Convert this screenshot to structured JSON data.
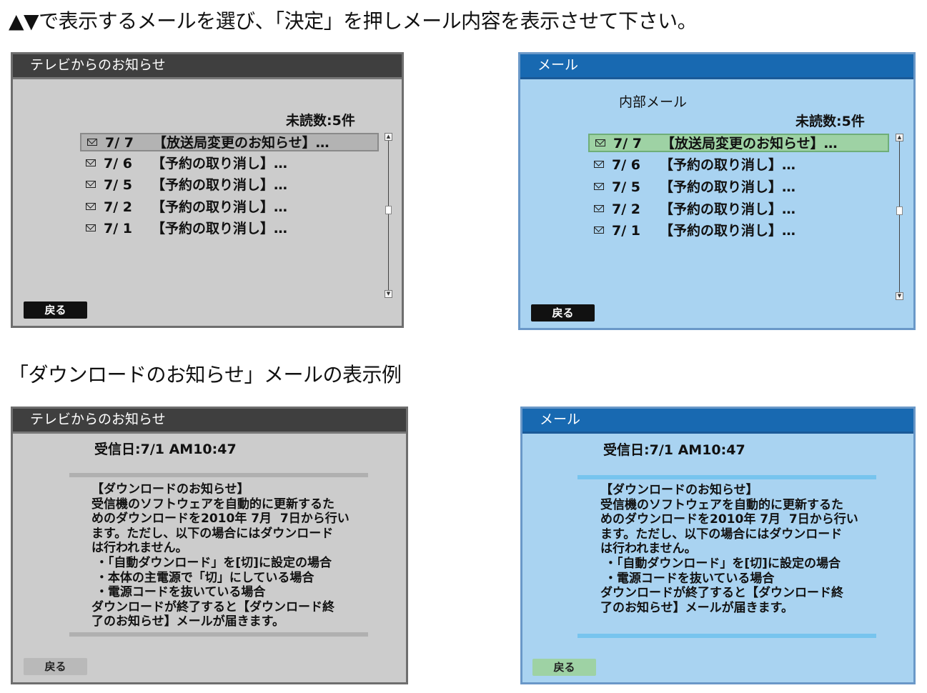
{
  "instruction": "▲▼で表示するメールを選び、「決定」を押しメール内容を表示させて下さい。",
  "example_heading": "「ダウンロードのお知らせ」メールの表示例",
  "gray_list": {
    "title": "テレビからのお知らせ",
    "unread": "未読数:5件",
    "back": "戻る",
    "rows": [
      {
        "date": "7/ 7",
        "subject": "【放送局変更のお知らせ】…"
      },
      {
        "date": "7/ 6",
        "subject": "【予約の取り消し】…"
      },
      {
        "date": "7/ 5",
        "subject": "【予約の取り消し】…"
      },
      {
        "date": "7/ 2",
        "subject": "【予約の取り消し】…"
      },
      {
        "date": "7/ 1",
        "subject": "【予約の取り消し】…"
      }
    ]
  },
  "blue_list": {
    "title": "メール",
    "subtitle": "内部メール",
    "unread": "未読数:5件",
    "back": "戻る",
    "rows": [
      {
        "date": "7/ 7",
        "subject": "【放送局変更のお知らせ】…"
      },
      {
        "date": "7/ 6",
        "subject": "【予約の取り消し】…"
      },
      {
        "date": "7/ 5",
        "subject": "【予約の取り消し】…"
      },
      {
        "date": "7/ 2",
        "subject": "【予約の取り消し】…"
      },
      {
        "date": "7/ 1",
        "subject": "【予約の取り消し】…"
      }
    ]
  },
  "gray_detail": {
    "title": "テレビからのお知らせ",
    "received": "受信日:7/1 AM10:47",
    "body": "【ダウンロードのお知らせ】\n受信機のソフトウェアを自動的に更新するた\nめのダウンロードを2010年 7月  7日から行い\nます。ただし、以下の場合にはダウンロード\nは行われません。\n ・「自動ダウンロード」を[切]に設定の場合\n ・本体の主電源で「切」にしている場合\n ・電源コードを抜いている場合\nダウンロードが終了すると【ダウンロード終\n了のお知らせ】メールが届きます。",
    "back": "戻る"
  },
  "blue_detail": {
    "title": "メール",
    "received": "受信日:7/1 AM10:47",
    "body": "【ダウンロードのお知らせ】\n受信機のソフトウェアを自動的に更新するた\nめのダウンロードを2010年 7月  7日から行い\nます。ただし、以下の場合にはダウンロード\nは行われません。\n ・「自動ダウンロード」を[切]に設定の場合\n ・電源コードを抜いている場合\nダウンロードが終了すると【ダウンロード終\n了のお知らせ】メールが届きます。",
    "back": "戻る"
  },
  "icons": {
    "mail": "envelope-icon",
    "scroll_up": "scroll-up-arrow-icon",
    "scroll_down": "scroll-down-arrow-icon"
  },
  "colors": {
    "gray_panel": "#cccccc",
    "gray_title": "#3f3f3f",
    "blue_panel": "#a9d3f1",
    "blue_title": "#1869b1",
    "blue_selected": "#9ed2a4"
  }
}
